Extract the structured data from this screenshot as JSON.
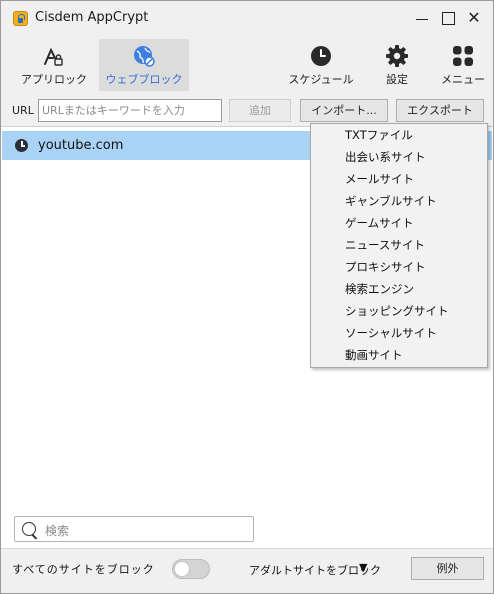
{
  "window": {
    "title": "Cisdem AppCrypt",
    "minimize_icon": "minimize-icon",
    "maximize_icon": "maximize-icon",
    "close_glyph": "✕"
  },
  "toolbar": {
    "applock_label": "アプリロック",
    "webblock_label": "ウェブブロック",
    "schedule_label": "スケジュール",
    "settings_label": "設定",
    "menu_label": "メニュー",
    "active_tab": "ウェブブロック",
    "active_color": "#2f6fd1"
  },
  "url_bar": {
    "label": "URL",
    "value": "",
    "placeholder": "URLまたはキーワードを入力",
    "add_label": "追加",
    "import_label": "インポート...",
    "export_label": "エクスポート"
  },
  "list": {
    "items": [
      {
        "text": "youtube.com",
        "icon": "clock-icon",
        "selected": true
      }
    ],
    "selected_color": "#a9d3f5"
  },
  "import_menu": {
    "items": [
      "TXTファイル",
      "出会い系サイト",
      "メールサイト",
      "ギャンブルサイト",
      "ゲームサイト",
      "ニュースサイト",
      "プロキシサイト",
      "検索エンジン",
      "ショッピングサイト",
      "ソーシャルサイト",
      "動画サイト"
    ]
  },
  "search": {
    "placeholder": "検索",
    "icon": "search-icon"
  },
  "bottom": {
    "block_all_label": "すべてのサイトをブロック",
    "block_all_on": false,
    "adult_block_label": "アダルトサイトをブロック",
    "adult_caret": "▼",
    "exception_label": "例外"
  }
}
